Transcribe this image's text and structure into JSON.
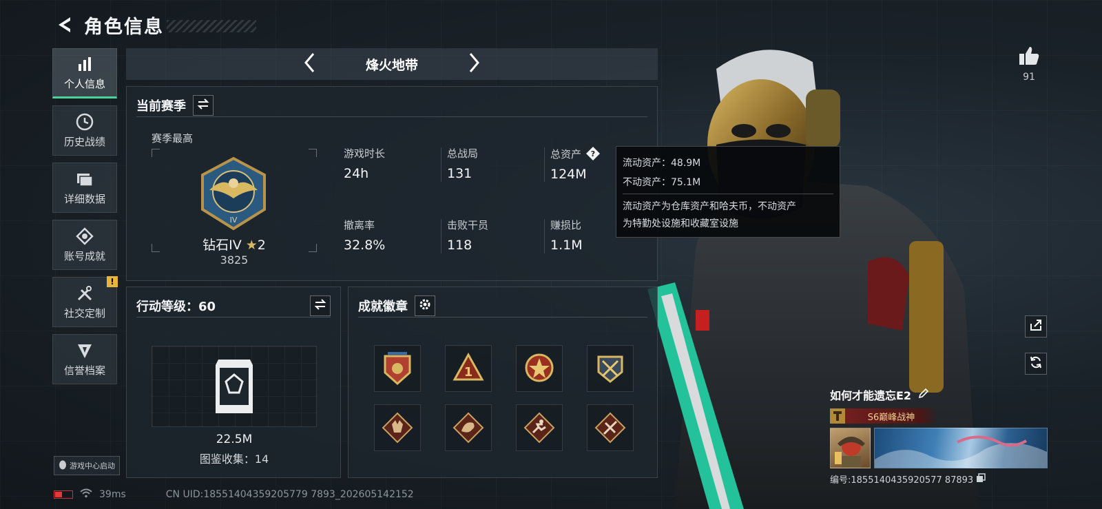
{
  "header": {
    "title": "角色信息"
  },
  "sidebar": {
    "items": [
      {
        "label": "个人信息",
        "icon": "bar-chart-icon",
        "active": true
      },
      {
        "label": "历史战绩",
        "icon": "clock-icon"
      },
      {
        "label": "详细数据",
        "icon": "folder-icon"
      },
      {
        "label": "账号成就",
        "icon": "achievement-icon"
      },
      {
        "label": "社交定制",
        "icon": "tools-icon",
        "alert": "!"
      },
      {
        "label": "信誉档案",
        "icon": "shield-icon"
      }
    ],
    "game_center": "游戏中心启动"
  },
  "map": {
    "name": "烽火地带"
  },
  "season": {
    "title": "当前赛季",
    "best_label": "赛季最高",
    "rank_name": "钻石IV",
    "rank_stars": "2",
    "rank_score": "3825",
    "stats": [
      {
        "label": "游戏时长",
        "value": "24h"
      },
      {
        "label": "总战局",
        "value": "131"
      },
      {
        "label": "总资产",
        "value": "124M"
      },
      {
        "label": "撤离率",
        "value": "32.8%"
      },
      {
        "label": "击败干员",
        "value": "118"
      },
      {
        "label": "赚损比",
        "value": "1.1M"
      }
    ]
  },
  "tooltip": {
    "liquid": "流动资产：48.9M",
    "fixed": "不动资产：75.1M",
    "desc_line1": "流动资产为仓库资产和哈夫币，不动资产",
    "desc_line2": "为特勤处设施和收藏室设施"
  },
  "level": {
    "title": "行动等级：60",
    "value": "22.5M",
    "collection": "图鉴收集：14"
  },
  "achievements": {
    "title": "成就徽章",
    "badges": [
      "badge-emblem-icon",
      "badge-rank-one-icon",
      "badge-star-medal-icon",
      "badge-crossed-swords-icon",
      "badge-wolf-icon",
      "badge-dragon-icon",
      "badge-runner-icon",
      "badge-tools-icon"
    ]
  },
  "player": {
    "like_count": "91",
    "name": "如何才能遗忘E2",
    "title": "S6巅峰战神",
    "id_text": "编号:1855140435920577 87893"
  },
  "footer": {
    "ping": "39ms",
    "uid": "CN UID:18551404359205779 7893_202605142152"
  },
  "colors": {
    "accent": "#48d49a",
    "alert": "#e8b43c",
    "title_red": "#7a2020"
  }
}
